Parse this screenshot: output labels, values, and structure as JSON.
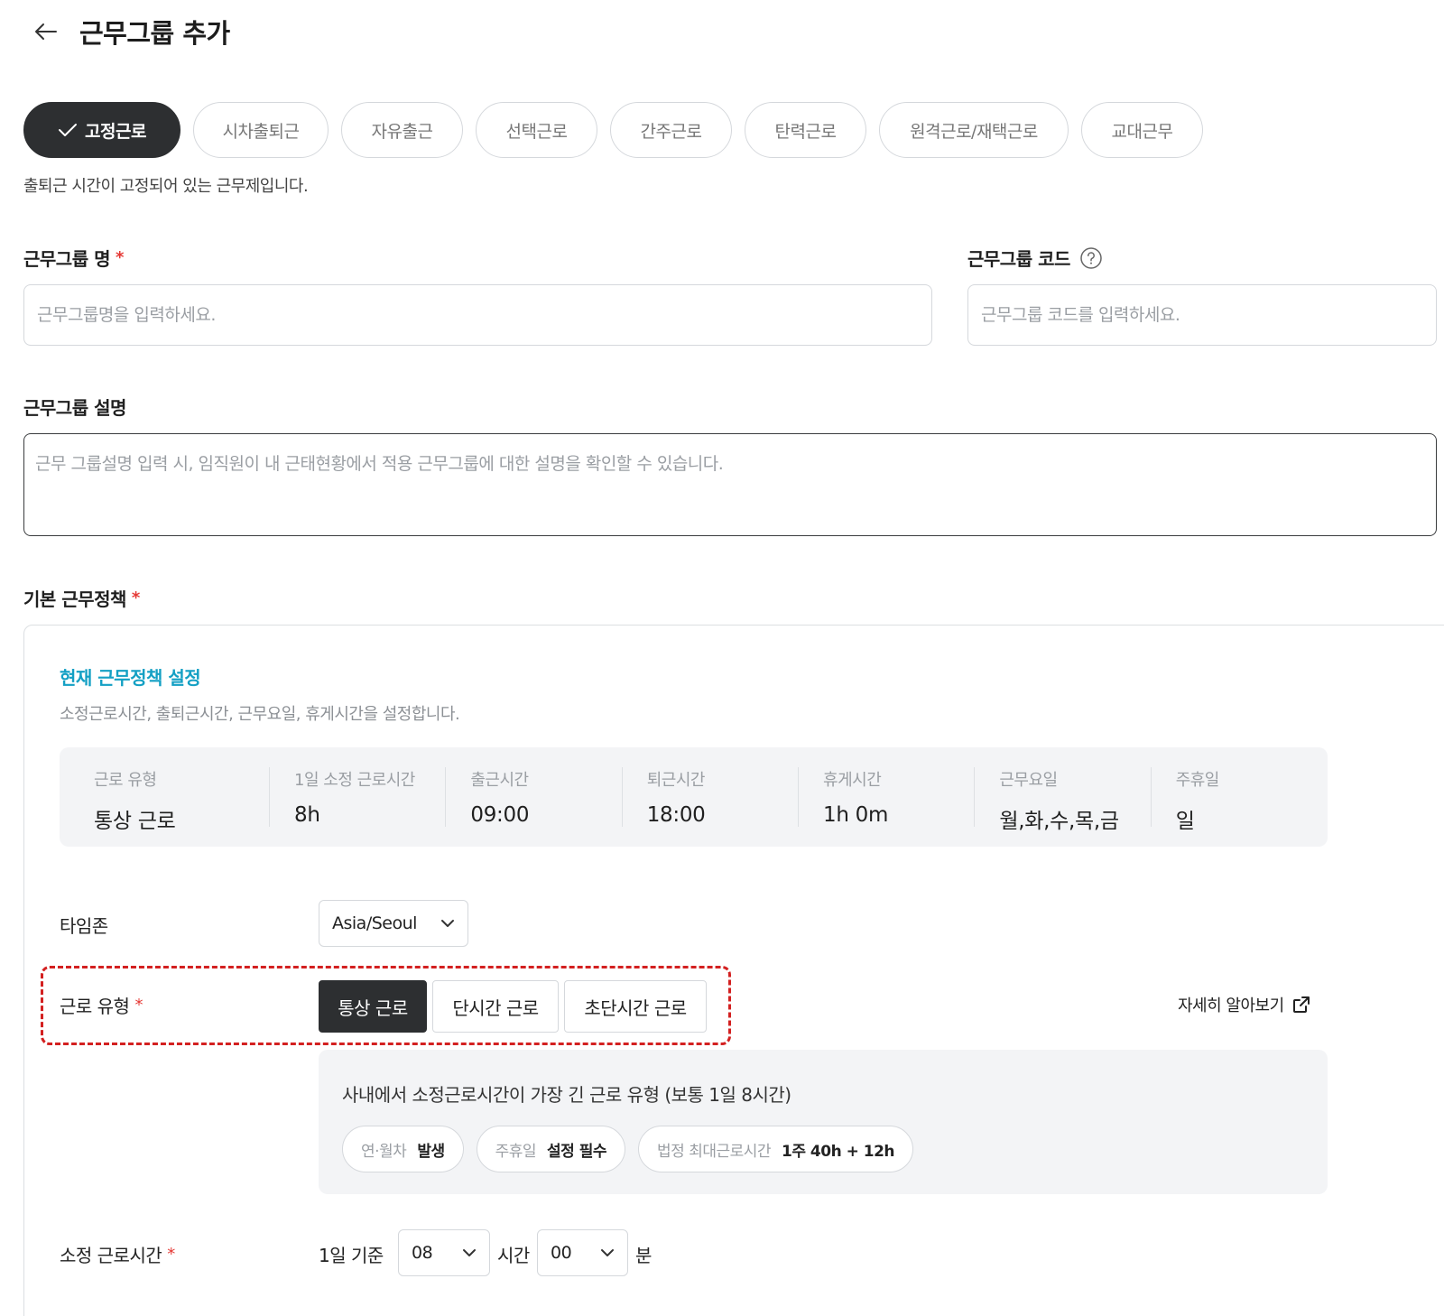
{
  "header": {
    "title": "근무그룹 추가",
    "back_icon": "arrow-left-icon"
  },
  "work_types": {
    "tabs": [
      "고정근로",
      "시차출퇴근",
      "자유출근",
      "선택근로",
      "간주근로",
      "탄력근로",
      "원격근로/재택근로",
      "교대근무"
    ],
    "selected": "고정근로",
    "description": "출퇴근 시간이 고정되어 있는 근무제입니다."
  },
  "form": {
    "name_label": "근무그룹 명",
    "name_placeholder": "근무그룹명을 입력하세요.",
    "code_label": "근무그룹 코드",
    "code_placeholder": "근무그룹 코드를 입력하세요.",
    "desc_label": "근무그룹 설명",
    "desc_placeholder": "근무 그룹설명 입력 시, 임직원이 내 근태현황에서 적용 근무그룹에 대한 설명을 확인할 수 있습니다.",
    "required_mark": "*"
  },
  "policy": {
    "section_label": "기본 근무정책",
    "title": "현재 근무정책 설정",
    "subtitle": "소정근로시간, 출퇴근시간, 근무요일, 휴게시간을 설정합니다.",
    "summary": [
      {
        "label": "근로 유형",
        "value": "통상 근로"
      },
      {
        "label": "1일 소정 근로시간",
        "value": "8h"
      },
      {
        "label": "출근시간",
        "value": "09:00"
      },
      {
        "label": "퇴근시간",
        "value": "18:00"
      },
      {
        "label": "휴게시간",
        "value": "1h 0m"
      },
      {
        "label": "근무요일",
        "value": "월,화,수,목,금"
      },
      {
        "label": "주휴일",
        "value": "일"
      }
    ],
    "timezone_label": "타임존",
    "timezone_value": "Asia/Seoul",
    "labor_type_label": "근로 유형",
    "labor_types": [
      "통상 근로",
      "단시간 근로",
      "초단시간 근로"
    ],
    "labor_type_selected": "통상 근로",
    "learn_more": "자세히 알아보기",
    "info_text": "사내에서 소정근로시간이 가장 긴 근로 유형 (보통 1일 8시간)",
    "chips": [
      {
        "key": "연·월차",
        "value": "발생"
      },
      {
        "key": "주휴일",
        "value": "설정 필수"
      },
      {
        "key": "법정 최대근로시간",
        "value": "1주 40h + 12h"
      }
    ],
    "work_hours_label": "소정 근로시간",
    "daily_basis": "1일 기준",
    "hours_value": "08",
    "hours_unit": "시간",
    "minutes_value": "00",
    "minutes_unit": "분"
  },
  "colors": {
    "accent": "#14a0c4",
    "dark": "#2d2f31",
    "required": "#e53935",
    "highlight": "#d32020"
  }
}
